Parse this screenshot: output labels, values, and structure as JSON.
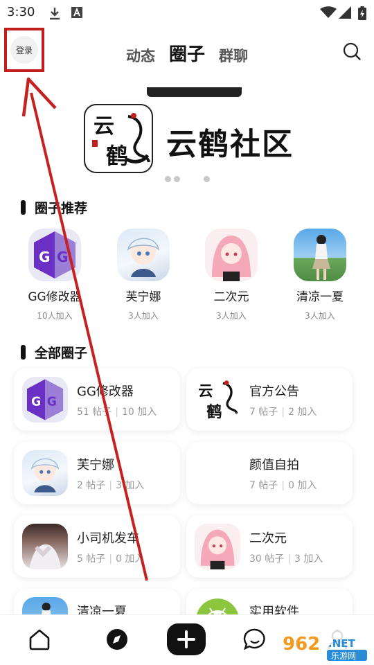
{
  "status_bar": {
    "time": "3:30",
    "icons": [
      "download-icon",
      "text-a-icon",
      "wifi-icon",
      "signal-icon",
      "battery-charging-icon"
    ]
  },
  "header": {
    "login_label": "登录",
    "tabs": [
      {
        "label": "动态",
        "active": false
      },
      {
        "label": "圈子",
        "active": true
      },
      {
        "label": "群聊",
        "active": false
      }
    ],
    "search_icon": "search-icon"
  },
  "banner": {
    "logo_text_top": "云",
    "logo_text_bottom": "鹤",
    "title": "云鹤社区",
    "page_dots": 3
  },
  "recommended": {
    "title": "圈子推荐",
    "items": [
      {
        "name": "GG修改器",
        "joins": "10人加入"
      },
      {
        "name": "芙宁娜",
        "joins": "3人加入"
      },
      {
        "name": "二次元",
        "joins": "3人加入"
      },
      {
        "name": "清凉一夏",
        "joins": "3人加入"
      }
    ]
  },
  "all_circles": {
    "title": "全部圈子",
    "items": [
      {
        "name": "GG修改器",
        "posts": "51 帖子",
        "joins": "10 加入"
      },
      {
        "name": "官方公告",
        "posts": "7 帖子",
        "joins": "2 加入"
      },
      {
        "name": "芙宁娜",
        "posts": "2 帖子",
        "joins": "3 加入"
      },
      {
        "name": "颜值自拍",
        "posts": "7 帖子",
        "joins": "0 加入"
      },
      {
        "name": "小司机发车",
        "posts": "5 帖子",
        "joins": "0 加入"
      },
      {
        "name": "二次元",
        "posts": "30 帖子",
        "joins": "3 加入"
      },
      {
        "name": "清凉一夏",
        "posts": "",
        "joins": ""
      },
      {
        "name": "实用软件",
        "posts": "",
        "joins": ""
      }
    ]
  },
  "bottom_nav": {
    "items": [
      "home-icon",
      "compass-icon",
      "add-icon",
      "message-icon",
      "profile-icon"
    ]
  },
  "watermark": {
    "number": "962",
    "suffix": ".NET",
    "subtitle": "乐游网"
  },
  "colors": {
    "accent_red": "#c41d1d",
    "gg_purple": "#6a2fc4",
    "android_green": "#8cc63f"
  }
}
